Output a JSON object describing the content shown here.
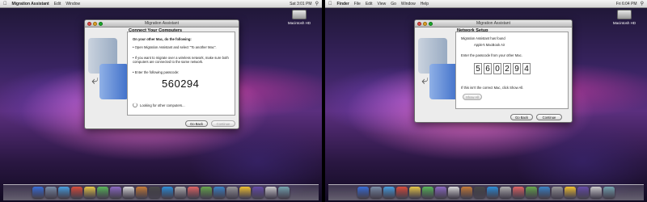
{
  "left": {
    "menubar": {
      "app": "Migration Assistant",
      "items": [
        "Edit",
        "Window"
      ],
      "clock": "Sat 3:01 PM"
    },
    "desktop_icon": "Macintosh HD",
    "window": {
      "title": "Migration Assistant",
      "heading": "Connect Your Computers",
      "instruction_intro": "On your other Mac, do the following:",
      "step1": "• Open Migration Assistant and select \"To another Mac\".",
      "step2": "• If you want to migrate over a wireless network, make sure both computers are connected to the same network.",
      "step3": "• Enter the following passcode:",
      "passcode": "560294",
      "status": "Looking for other computers...",
      "go_back": "Go Back",
      "continue": "Continue"
    }
  },
  "right": {
    "menubar": {
      "app": "Finder",
      "items": [
        "File",
        "Edit",
        "View",
        "Go",
        "Window",
        "Help"
      ],
      "clock": "Fri 6:04 PM"
    },
    "desktop_icon": "Macintosh HD",
    "window": {
      "title": "Migration Assistant",
      "heading": "Network Setup",
      "found_label": "Migration Assistant has found",
      "found_computer": "Apple's MacBook Air",
      "enter_prompt": "Enter the passcode from your other Mac.",
      "digits": [
        "5",
        "6",
        "0",
        "2",
        "9",
        "4"
      ],
      "show_all_hint": "If this isn't the correct Mac, click Show All.",
      "show_all": "Show All",
      "go_back": "Go Back",
      "continue": "Continue"
    }
  },
  "dock_colors": [
    "#3a6fd8",
    "#7c8fa8",
    "#4aa0e0",
    "#d94f3d",
    "#e8c84a",
    "#5cb85c",
    "#8e6cc4",
    "#d9d9d9",
    "#c77d3a",
    "#4a4a4a",
    "#2f8fd8",
    "#b0b0b0",
    "#e06666",
    "#6aa84f",
    "#3d85c6",
    "#999999",
    "#f1c232",
    "#674ea7",
    "#cccccc",
    "#76a5af"
  ]
}
